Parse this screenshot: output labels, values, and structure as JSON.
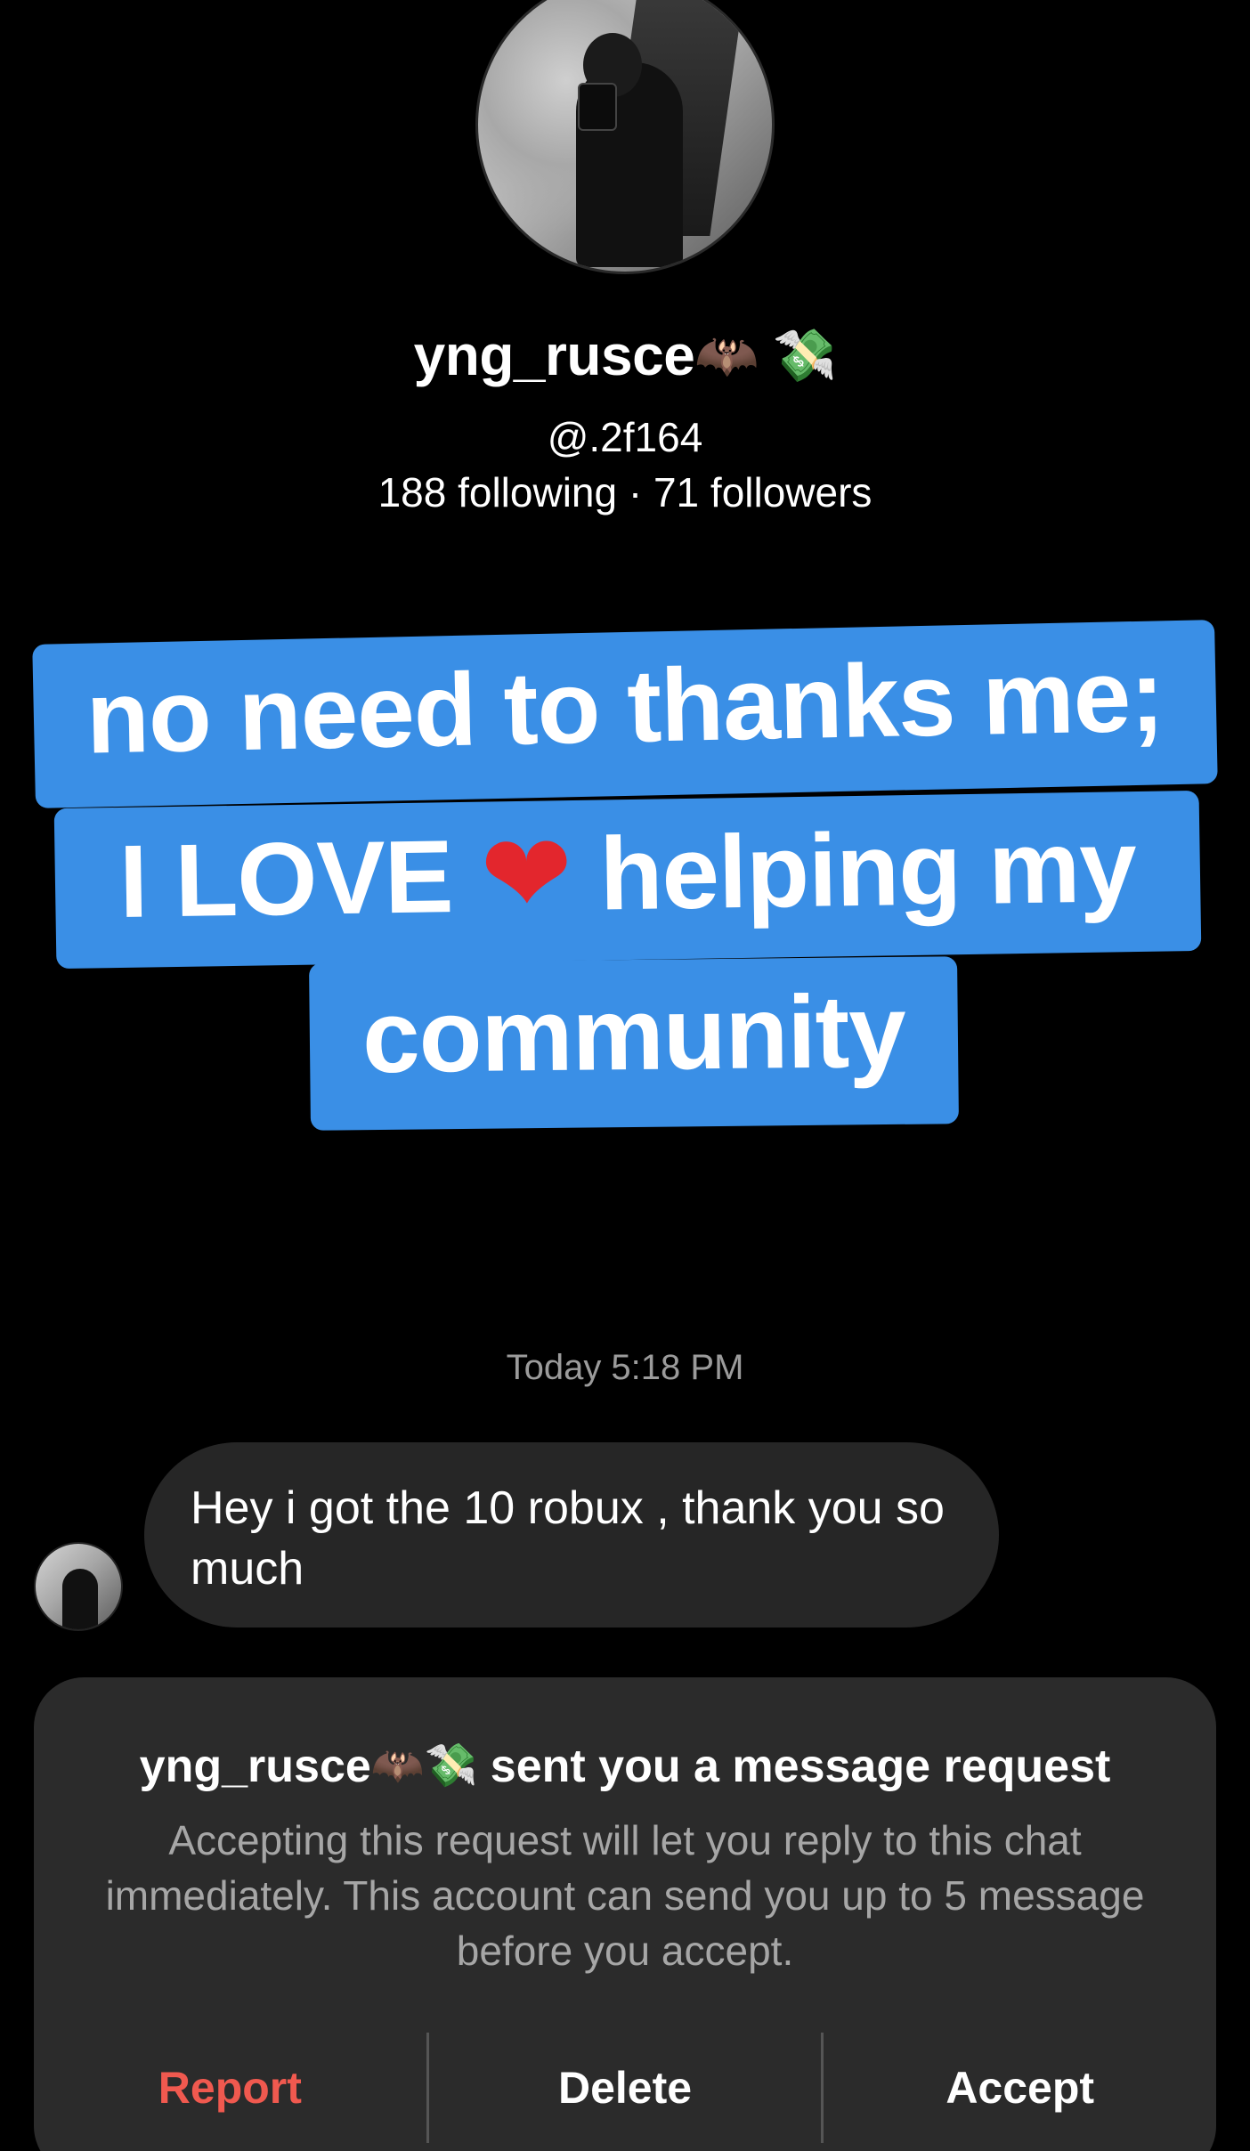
{
  "profile": {
    "display_name": "yng_rusce",
    "name_emoji": "🦇 💸",
    "handle": "@.2f164",
    "stats": "188 following · 71 followers",
    "avatar_icon": "profile-photo"
  },
  "caption": {
    "line1": "no need to thanks me;",
    "line2_pre": "I LOVE ",
    "line2_emoji": "❤",
    "line2_post": " helping my",
    "line3": "community",
    "background_color": "#3a8fe6"
  },
  "conversation": {
    "timestamp": "Today 5:18 PM",
    "messages": [
      {
        "text": "Hey i got the 10 robux , thank you so much",
        "from": "them"
      }
    ]
  },
  "request": {
    "title_name": "yng_rusce",
    "title_emoji": "🦇💸",
    "title_suffix": " sent you a message request",
    "body": "Accepting this request will let you reply to this chat immediately. This account can send you up to 5 message before you accept.",
    "actions": {
      "report": "Report",
      "delete": "Delete",
      "accept": "Accept"
    },
    "report_color": "#f0594f"
  }
}
